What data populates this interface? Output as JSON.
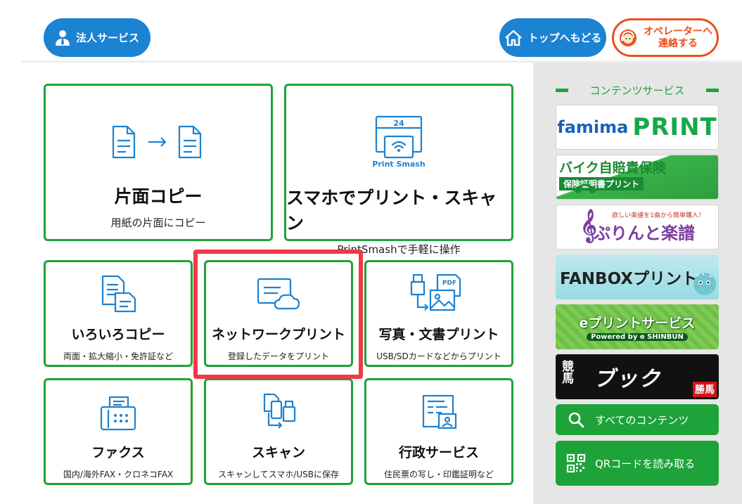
{
  "header": {
    "biz_label": "法人サービス",
    "top_label": "トップへもどる",
    "operator_line1": "オペレーターへ",
    "operator_line2": "連絡する"
  },
  "tiles": {
    "copy": {
      "title": "片面コピー",
      "sub": "用紙の片面にコピー"
    },
    "smash": {
      "title": "スマホでプリント・スキャン",
      "sub": "PrintSmashで手軽に操作",
      "icon_num": "24",
      "icon_text": "Print Smash"
    },
    "iroiro": {
      "title": "いろいろコピー",
      "sub": "両面・拡大縮小・免許証など"
    },
    "network": {
      "title": "ネットワークプリント",
      "sub": "登録したデータをプリント"
    },
    "photo": {
      "title": "写真・文書プリント",
      "sub": "USB/SDカードなどからプリント",
      "icon_pdf": "PDF"
    },
    "fax": {
      "title": "ファクス",
      "sub": "国内/海外FAX・クロネコFAX"
    },
    "scan": {
      "title": "スキャン",
      "sub": "スキャンしてスマホ/USBに保存"
    },
    "gyosei": {
      "title": "行政サービス",
      "sub": "住民票の写し・印鑑証明など"
    }
  },
  "contents": {
    "heading": "コンテンツサービス",
    "banners": {
      "famima_a": "famima",
      "famima_b": "PRINT",
      "bike_l1": "バイク自賠責保険",
      "bike_l2": "保険証明書プリント",
      "gakufu_small": "欲しい楽譜を1曲から簡単購入！",
      "gakufu_main": "ぷりんと楽譜",
      "fanbox": "FANBOXプリント",
      "eprint_main": "eプリントサービス",
      "eprint_sub": "Powered by e SHINBUN",
      "keiba_vert": "競馬",
      "keiba_main": "ブック",
      "keiba_red": "勝馬"
    },
    "all_contents": "すべてのコンテンツ",
    "qr": "QRコードを読み取る"
  },
  "colors": {
    "green": "#1ea33a",
    "blue": "#1c82d2",
    "orange": "#ea4f1b",
    "highlight": "#f03a45"
  }
}
